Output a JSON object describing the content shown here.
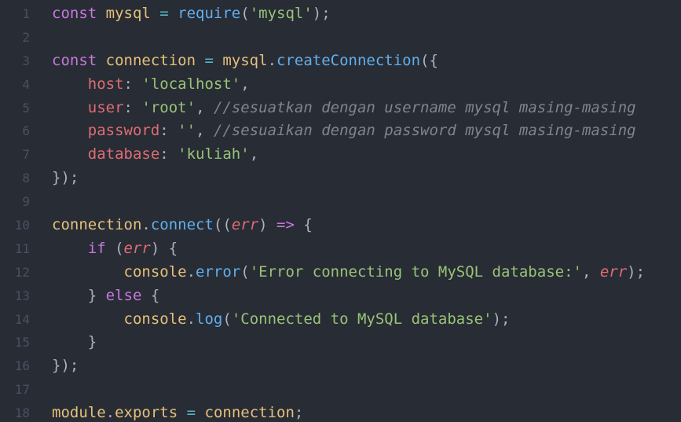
{
  "editor": {
    "language": "javascript",
    "colors": {
      "background": "#282c34",
      "line_number": "#495162",
      "keyword": "#c678dd",
      "variable": "#e5c07b",
      "function": "#61afef",
      "string": "#98c379",
      "property": "#e06c75",
      "comment": "#7f848e",
      "operator": "#56b6c2",
      "punctuation": "#abb2bf"
    },
    "lines": [
      {
        "number": "1",
        "tokens": [
          {
            "t": "keyword",
            "v": "const "
          },
          {
            "t": "variable",
            "v": "mysql"
          },
          {
            "t": "operator",
            "v": " = "
          },
          {
            "t": "func",
            "v": "require"
          },
          {
            "t": "punct",
            "v": "("
          },
          {
            "t": "string",
            "v": "'mysql'"
          },
          {
            "t": "punct",
            "v": ");"
          }
        ]
      },
      {
        "number": "2",
        "tokens": []
      },
      {
        "number": "3",
        "tokens": [
          {
            "t": "keyword",
            "v": "const "
          },
          {
            "t": "variable",
            "v": "connection"
          },
          {
            "t": "operator",
            "v": " = "
          },
          {
            "t": "variable",
            "v": "mysql"
          },
          {
            "t": "punct",
            "v": "."
          },
          {
            "t": "method",
            "v": "createConnection"
          },
          {
            "t": "punct",
            "v": "({"
          }
        ]
      },
      {
        "number": "4",
        "tokens": [
          {
            "t": "plain",
            "v": "    "
          },
          {
            "t": "prop",
            "v": "host"
          },
          {
            "t": "punct",
            "v": ": "
          },
          {
            "t": "string",
            "v": "'localhost'"
          },
          {
            "t": "punct",
            "v": ","
          }
        ]
      },
      {
        "number": "5",
        "tokens": [
          {
            "t": "plain",
            "v": "    "
          },
          {
            "t": "prop",
            "v": "user"
          },
          {
            "t": "punct",
            "v": ": "
          },
          {
            "t": "string",
            "v": "'root'"
          },
          {
            "t": "punct",
            "v": ", "
          },
          {
            "t": "comment",
            "v": "//sesuatkan dengan username mysql masing-masing"
          }
        ]
      },
      {
        "number": "6",
        "tokens": [
          {
            "t": "plain",
            "v": "    "
          },
          {
            "t": "prop",
            "v": "password"
          },
          {
            "t": "punct",
            "v": ": "
          },
          {
            "t": "string",
            "v": "''"
          },
          {
            "t": "punct",
            "v": ", "
          },
          {
            "t": "comment",
            "v": "//sesuaikan dengan password mysql masing-masing"
          }
        ]
      },
      {
        "number": "7",
        "tokens": [
          {
            "t": "plain",
            "v": "    "
          },
          {
            "t": "prop",
            "v": "database"
          },
          {
            "t": "punct",
            "v": ": "
          },
          {
            "t": "string",
            "v": "'kuliah'"
          },
          {
            "t": "punct",
            "v": ","
          }
        ]
      },
      {
        "number": "8",
        "tokens": [
          {
            "t": "punct",
            "v": "});"
          }
        ]
      },
      {
        "number": "9",
        "tokens": []
      },
      {
        "number": "10",
        "tokens": [
          {
            "t": "variable",
            "v": "connection"
          },
          {
            "t": "punct",
            "v": "."
          },
          {
            "t": "method",
            "v": "connect"
          },
          {
            "t": "punct",
            "v": "(("
          },
          {
            "t": "param",
            "v": "err"
          },
          {
            "t": "punct",
            "v": ") "
          },
          {
            "t": "keyword",
            "v": "=>"
          },
          {
            "t": "punct",
            "v": " {"
          }
        ]
      },
      {
        "number": "11",
        "tokens": [
          {
            "t": "plain",
            "v": "    "
          },
          {
            "t": "keyword",
            "v": "if"
          },
          {
            "t": "punct",
            "v": " ("
          },
          {
            "t": "param",
            "v": "err"
          },
          {
            "t": "punct",
            "v": ") {"
          }
        ]
      },
      {
        "number": "12",
        "tokens": [
          {
            "t": "plain",
            "v": "        "
          },
          {
            "t": "object",
            "v": "console"
          },
          {
            "t": "punct",
            "v": "."
          },
          {
            "t": "method",
            "v": "error"
          },
          {
            "t": "punct",
            "v": "("
          },
          {
            "t": "string",
            "v": "'Error connecting to MySQL database:'"
          },
          {
            "t": "punct",
            "v": ", "
          },
          {
            "t": "param",
            "v": "err"
          },
          {
            "t": "punct",
            "v": ");"
          }
        ]
      },
      {
        "number": "13",
        "tokens": [
          {
            "t": "plain",
            "v": "    "
          },
          {
            "t": "punct",
            "v": "} "
          },
          {
            "t": "keyword",
            "v": "else"
          },
          {
            "t": "punct",
            "v": " {"
          }
        ]
      },
      {
        "number": "14",
        "tokens": [
          {
            "t": "plain",
            "v": "        "
          },
          {
            "t": "object",
            "v": "console"
          },
          {
            "t": "punct",
            "v": "."
          },
          {
            "t": "method",
            "v": "log"
          },
          {
            "t": "punct",
            "v": "("
          },
          {
            "t": "string",
            "v": "'Connected to MySQL database'"
          },
          {
            "t": "punct",
            "v": ");"
          }
        ]
      },
      {
        "number": "15",
        "tokens": [
          {
            "t": "plain",
            "v": "    "
          },
          {
            "t": "punct",
            "v": "}"
          }
        ]
      },
      {
        "number": "16",
        "tokens": [
          {
            "t": "punct",
            "v": "});"
          }
        ]
      },
      {
        "number": "17",
        "tokens": []
      },
      {
        "number": "18",
        "tokens": [
          {
            "t": "variable",
            "v": "module"
          },
          {
            "t": "punct",
            "v": "."
          },
          {
            "t": "variable",
            "v": "exports"
          },
          {
            "t": "operator",
            "v": " = "
          },
          {
            "t": "variable",
            "v": "connection"
          },
          {
            "t": "punct",
            "v": ";"
          }
        ]
      }
    ]
  }
}
